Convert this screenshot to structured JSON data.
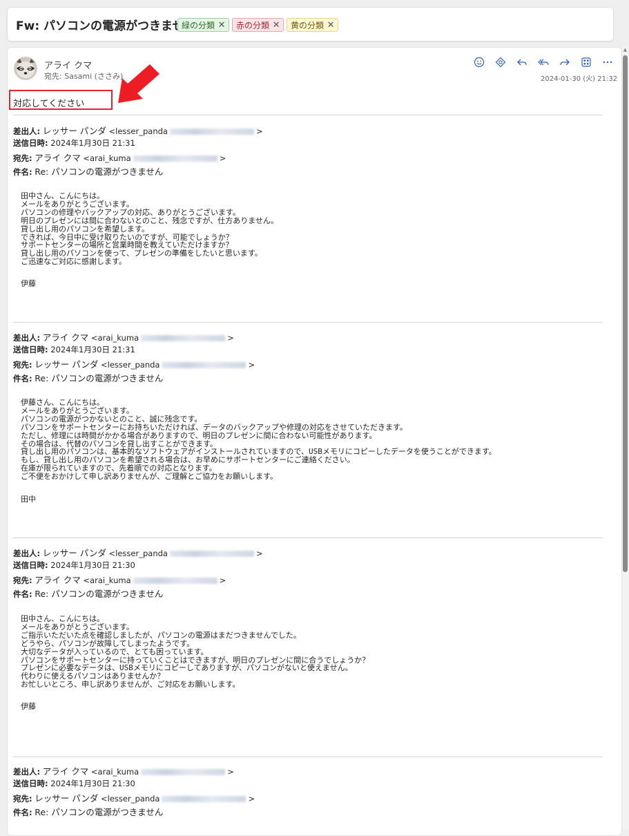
{
  "subject": "Fw: パソコンの電源がつきません",
  "categories": [
    {
      "label": "緑の分類",
      "color": "#e6f4e6"
    },
    {
      "label": "赤の分類",
      "color": "#fbe4e6"
    },
    {
      "label": "黄の分類",
      "color": "#fdf6d3"
    }
  ],
  "message": {
    "sender": "アライ クマ",
    "recipient_label": "宛先:",
    "recipient": "Sasami (ささみ)",
    "date": "2024-01-30 (火) 21:32",
    "note": "対応してください",
    "actions": [
      "smile-icon",
      "sticker-icon",
      "reply-icon",
      "reply-all-icon",
      "forward-icon",
      "apps-icon",
      "more-icon"
    ]
  },
  "labels": {
    "from": "差出人:",
    "sent": "送信日時:",
    "to": "宛先:",
    "subject": "件名:",
    "gt": ">"
  },
  "quotes": [
    {
      "from_name": "レッサー パンダ",
      "from_addr": "<lesser_panda",
      "sent": "2024年1月30日 21:31",
      "to_name": "アライ クマ",
      "to_addr": "<arai_kuma",
      "subject": "Re: パソコンの電源がつきません",
      "body": "田中さん、こんにちは。\nメールをありがとうございます。\nパソコンの修理やバックアップの対応、ありがとうございます。\n明日のプレゼンには間に合わないとのこと、残念ですが、仕方ありません。\n貸し出し用のパソコンを希望します。\nできれば、今日中に受け取りたいのですが、可能でしょうか？\nサポートセンターの場所と営業時間を教えていただけますか？\n貸し出し用のパソコンを使って、プレゼンの準備をしたいと思います。\nご迅速なご対応に感謝します。",
      "signature": "伊藤"
    },
    {
      "from_name": "アライ クマ",
      "from_addr": "<arai_kuma",
      "sent": "2024年1月30日 21:31",
      "to_name": "レッサー パンダ",
      "to_addr": "<lesser_panda",
      "subject": "Re: パソコンの電源がつきません",
      "body": "伊藤さん、こんにちは。\nメールをありがとうございます。\nパソコンの電源がつかないとのこと、誠に残念です。\nパソコンをサポートセンターにお持ちいただければ、データのバックアップや修理の対応をさせていただきます。\nただし、修理には時間がかかる場合がありますので、明日のプレゼンに間に合わない可能性があります。\nその場合は、代替のパソコンを貸し出すことができます。\n貸し出し用のパソコンは、基本的なソフトウェアがインストールされていますので、USBメモリにコピーしたデータを使うことができます。\nもし、貸し出し用のパソコンを希望される場合は、お早めにサポートセンターにご連絡ください。\n在庫が限られていますので、先着順での対応となります。\nご不便をおかけして申し訳ありませんが、ご理解とご協力をお願いします。",
      "signature": "田中"
    },
    {
      "from_name": "レッサー パンダ",
      "from_addr": "<lesser_panda",
      "sent": "2024年1月30日 21:30",
      "to_name": "アライ クマ",
      "to_addr": "<arai_kuma",
      "subject": "Re: パソコンの電源がつきません",
      "body": "田中さん、こんにちは。\nメールをありがとうございます。\nご指示いただいた点を確認しましたが、パソコンの電源はまだつきませんでした。\nどうやら、パソコンが故障してしまったようです。\n大切なデータが入っているので、とても困っています。\nパソコンをサポートセンターに持っていくことはできますが、明日のプレゼンに間に合うでしょうか？\nプレゼンに必要なデータは、USBメモリにコピーしてありますが、パソコンがないと使えません。\n代わりに使えるパソコンはありませんか？\nお忙しいところ、申し訳ありませんが、ご対応をお願いします。",
      "signature": "伊藤"
    },
    {
      "from_name": "アライ クマ",
      "from_addr": "<arai_kuma",
      "sent": "2024年1月30日 21:30",
      "to_name": "レッサー パンダ",
      "to_addr": "<lesser_panda",
      "subject": "Re: パソコンの電源がつきません",
      "body": "",
      "signature": ""
    }
  ]
}
